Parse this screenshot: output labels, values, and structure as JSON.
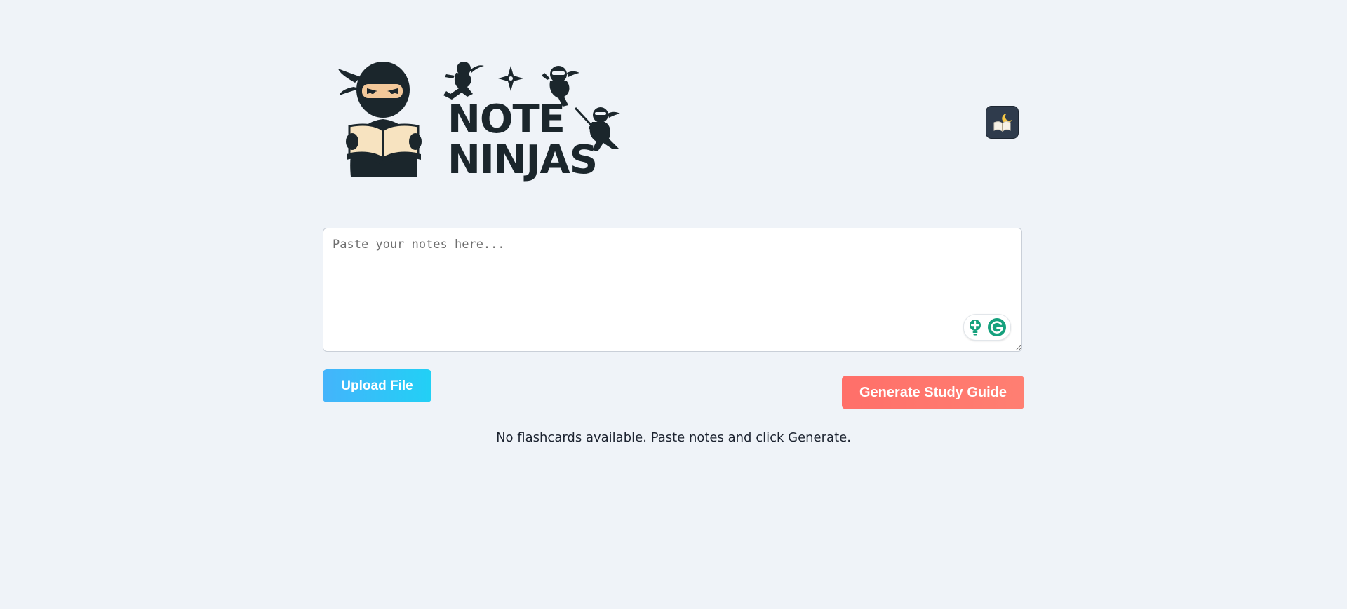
{
  "logo": {
    "line1": "NOTE",
    "line2": "NINJAS"
  },
  "theme_toggle": {
    "icon": "moon-book-icon"
  },
  "notes": {
    "value": "",
    "placeholder": "Paste your notes here..."
  },
  "buttons": {
    "upload_label": "Upload File",
    "generate_label": "Generate Study Guide"
  },
  "status": {
    "empty_message": "No flashcards available. Paste notes and click Generate."
  },
  "colors": {
    "background": "#eff3f8",
    "logo_dark": "#1b262c",
    "upload_gradient_start": "#44b4fb",
    "upload_gradient_end": "#22d0f5",
    "generate": "#ff6f69",
    "toggle_bg": "#2f3b4c"
  }
}
